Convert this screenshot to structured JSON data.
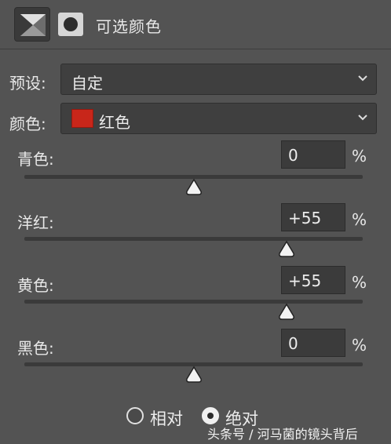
{
  "header": {
    "title": "可选颜色"
  },
  "preset": {
    "label": "预设:",
    "value": "自定"
  },
  "colors": {
    "label": "颜色:",
    "value": "红色",
    "swatch_color": "#c8261a"
  },
  "sliders": [
    {
      "label": "青色:",
      "value": "0",
      "unit": "%",
      "level": 0
    },
    {
      "label": "洋红:",
      "value": "+55",
      "unit": "%",
      "level": 55
    },
    {
      "label": "黄色:",
      "value": "+55",
      "unit": "%",
      "level": 55
    },
    {
      "label": "黑色:",
      "value": "0",
      "unit": "%",
      "level": 0
    }
  ],
  "method": {
    "options": [
      {
        "label": "相对",
        "selected": false
      },
      {
        "label": "绝对",
        "selected": true
      }
    ]
  },
  "watermark": "头条号 / 河马菌的镜头背后"
}
